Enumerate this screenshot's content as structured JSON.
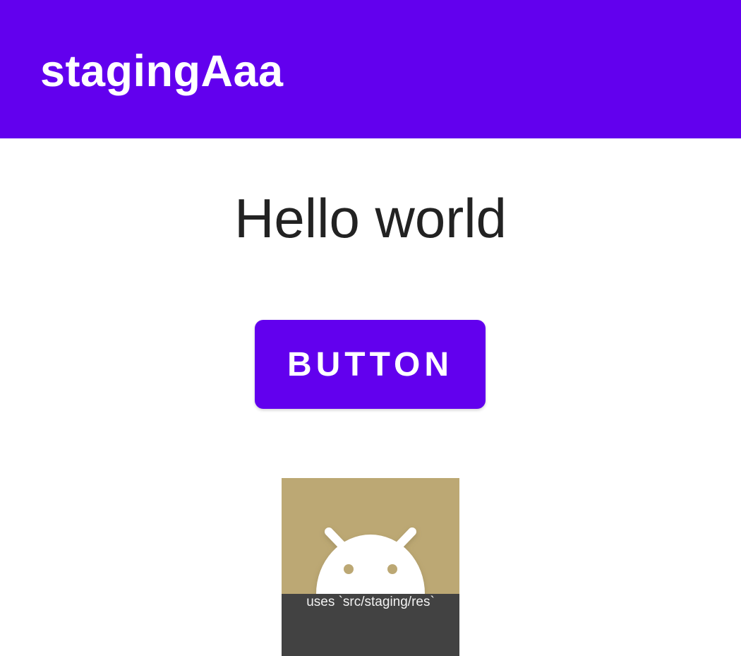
{
  "app_bar": {
    "title": "stagingAaa",
    "color": "#6200ee"
  },
  "main": {
    "greeting": "Hello world",
    "button_label": "BUTTON",
    "button_color": "#6200ee"
  },
  "launcher_tile": {
    "icon": "android-robot-icon",
    "background_color": "#bca874",
    "caption": "uses `src/staging/res`",
    "caption_background": "#424242"
  }
}
